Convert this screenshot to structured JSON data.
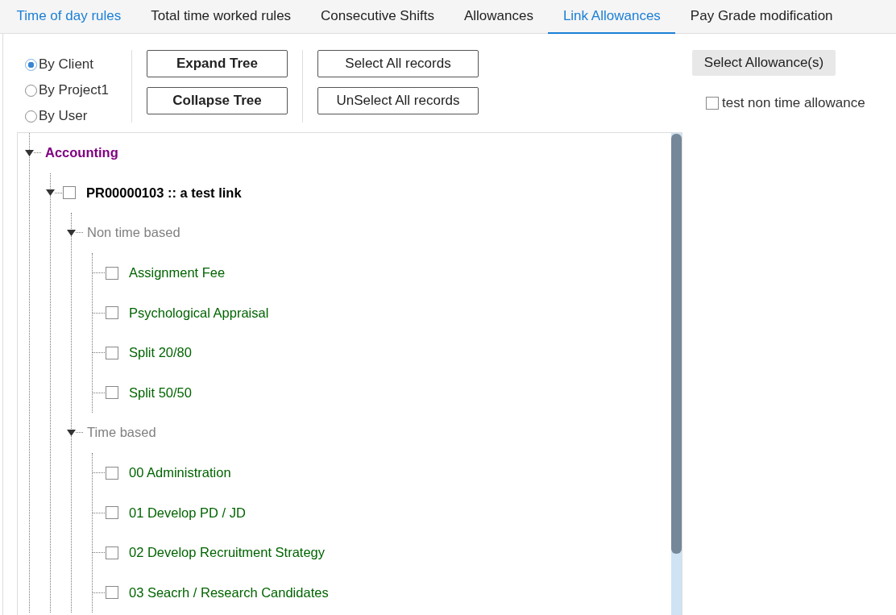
{
  "tabs": [
    {
      "label": "Time of day rules",
      "selected": false,
      "highlighted": true
    },
    {
      "label": "Total time worked rules",
      "selected": false,
      "highlighted": false
    },
    {
      "label": "Consecutive Shifts",
      "selected": false,
      "highlighted": false
    },
    {
      "label": "Allowances",
      "selected": false,
      "highlighted": false
    },
    {
      "label": "Link Allowances",
      "selected": true,
      "highlighted": false
    },
    {
      "label": "Pay Grade modification",
      "selected": false,
      "highlighted": false
    }
  ],
  "group_by": [
    {
      "label": "By Client",
      "selected": true
    },
    {
      "label": "By Project1",
      "selected": false
    },
    {
      "label": "By User",
      "selected": false
    }
  ],
  "tree_buttons": [
    "Expand Tree",
    "Collapse Tree"
  ],
  "record_buttons": [
    "Select All records",
    "UnSelect All records"
  ],
  "select_allowance_button": "Select Allowance(s)",
  "allowance_options": [
    {
      "label": "test non time allowance",
      "checked": false
    }
  ],
  "tree": [
    {
      "kind": "client",
      "label": "Accounting",
      "expanded": true,
      "children": [
        {
          "kind": "project",
          "label": "PR00000103 :: a test link",
          "checked": false,
          "expanded": true,
          "children": [
            {
              "kind": "group",
              "label": "Non time based",
              "expanded": true,
              "children": [
                {
                  "kind": "allowance",
                  "label": "Assignment Fee",
                  "checked": false
                },
                {
                  "kind": "allowance",
                  "label": "Psychological Appraisal",
                  "checked": false
                },
                {
                  "kind": "allowance",
                  "label": "Split 20/80",
                  "checked": false
                },
                {
                  "kind": "allowance",
                  "label": "Split 50/50",
                  "checked": false
                }
              ]
            },
            {
              "kind": "group",
              "label": "Time based",
              "expanded": true,
              "children": [
                {
                  "kind": "allowance",
                  "label": "00 Administration",
                  "checked": false
                },
                {
                  "kind": "allowance",
                  "label": "01 Develop PD / JD",
                  "checked": false
                },
                {
                  "kind": "allowance",
                  "label": "02 Develop Recruitment Strategy",
                  "checked": false
                },
                {
                  "kind": "allowance",
                  "label": "03 Seacrh / Research Candidates",
                  "checked": false
                }
              ]
            }
          ]
        }
      ]
    }
  ]
}
